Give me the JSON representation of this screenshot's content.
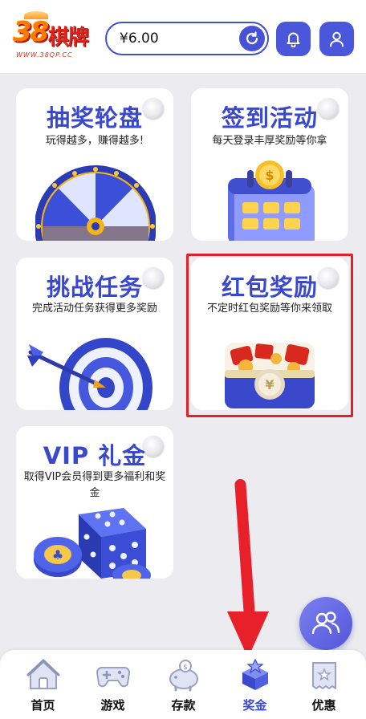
{
  "header": {
    "logo_text": "38棋牌",
    "logo_url": "WWW.38QP.CC",
    "balance": "¥6.00"
  },
  "cards": [
    {
      "title": "抽奖轮盘",
      "desc": "玩得越多，赚得越多!"
    },
    {
      "title": "签到活动",
      "desc": "每天登录丰厚奖励等你拿"
    },
    {
      "title": "挑战任务",
      "desc": "完成活动任务获得更多奖励"
    },
    {
      "title": "红包奖励",
      "desc": "不定时红包奖励等你来领取"
    },
    {
      "title": "VIP 礼金",
      "desc": "取得VIP会员得到更多福利和奖金"
    }
  ],
  "nav": [
    {
      "label": "首页"
    },
    {
      "label": "游戏"
    },
    {
      "label": "存款"
    },
    {
      "label": "奖金",
      "active": true
    },
    {
      "label": "优惠"
    }
  ],
  "colors": {
    "accent": "#4b57db",
    "title_blue": "#3a48cc",
    "highlight_red": "#e0202a"
  },
  "icons": [
    "refresh-icon",
    "bell-icon",
    "user-icon",
    "community-icon",
    "home-icon",
    "gamepad-icon",
    "piggy-bank-icon",
    "gift-box-icon",
    "coupon-icon"
  ]
}
